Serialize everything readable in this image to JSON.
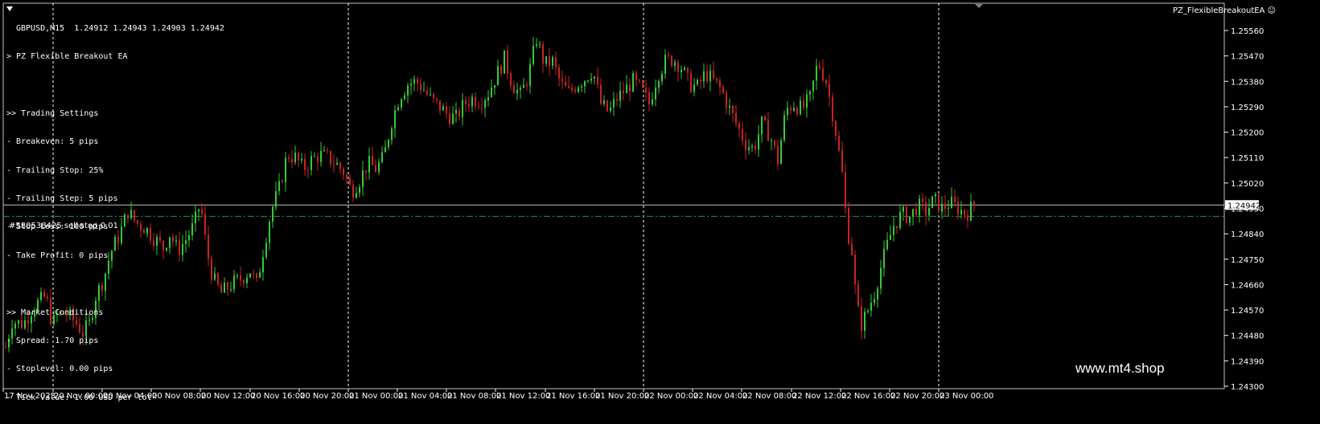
{
  "header": {
    "symbol_line": "GBPUSD,M15  1.24912 1.24943 1.24903 1.24942",
    "ea_line": "> PZ Flexible Breakout EA"
  },
  "panel": {
    "lines": [
      ">> Trading Settings",
      "- Breakeven: 5 pips",
      "- Trailing Stop: 25%",
      "- Trailing Step: 5 pips",
      "- Stop Loss: 100 pips",
      "- Take Profit: 0 pips",
      "",
      ">> Market Conditions",
      "- Spread: 1.70 pips",
      "- Stoplevel: 0.00 pips",
      "- Tick Value: 1.00 USD per lot"
    ]
  },
  "ea_name": "PZ_FlexibleBreakoutEA ☺",
  "order_label": "#580538425 sell stop 0.01",
  "watermark": "www.mt4.shop",
  "colors": {
    "background": "#000000",
    "bull": "#33cc33",
    "bear": "#cc2222",
    "grid": "#ffffff",
    "bid_line": "#bfbfbf",
    "order_line": "#2e8b57"
  },
  "chart_data": {
    "type": "candlestick",
    "price_axis": {
      "ticks": [
        "1.25560",
        "1.25470",
        "1.25380",
        "1.25290",
        "1.25200",
        "1.25110",
        "1.25020",
        "1.24930",
        "1.24840",
        "1.24750",
        "1.24660",
        "1.24570",
        "1.24480",
        "1.24390",
        "1.24300"
      ],
      "range": [
        1.243,
        1.256
      ],
      "current_price": "1.24942",
      "order_price": 1.24902
    },
    "time_axis": {
      "labels": [
        "17 Nov 2023",
        "20 Nov 00:00",
        "20 Nov 04:00",
        "20 Nov 08:00",
        "20 Nov 12:00",
        "20 Nov 16:00",
        "20 Nov 20:00",
        "21 Nov 00:00",
        "21 Nov 04:00",
        "21 Nov 08:00",
        "21 Nov 12:00",
        "21 Nov 16:00",
        "21 Nov 20:00",
        "22 Nov 00:00",
        "22 Nov 04:00",
        "22 Nov 08:00",
        "22 Nov 12:00",
        "22 Nov 16:00",
        "22 Nov 20:00",
        "23 Nov 00:00"
      ],
      "day_separators": [
        "20 Nov 00:00",
        "21 Nov 00:00",
        "22 Nov 00:00",
        "23 Nov 00:00"
      ]
    },
    "close_path": [
      [
        0,
        1.2437
      ],
      [
        14,
        1.2453
      ],
      [
        28,
        1.2452
      ],
      [
        40,
        1.2458
      ],
      [
        56,
        1.2462
      ],
      [
        64,
        1.2452
      ],
      [
        70,
        1.2455
      ],
      [
        80,
        1.2456
      ],
      [
        92,
        1.2453
      ],
      [
        102,
        1.2449
      ],
      [
        110,
        1.2452
      ],
      [
        118,
        1.2462
      ],
      [
        128,
        1.2468
      ],
      [
        136,
        1.2477
      ],
      [
        148,
        1.2484
      ],
      [
        158,
        1.2492
      ],
      [
        168,
        1.2488
      ],
      [
        180,
        1.2486
      ],
      [
        192,
        1.2482
      ],
      [
        202,
        1.2479
      ],
      [
        210,
        1.2484
      ],
      [
        220,
        1.2478
      ],
      [
        230,
        1.2482
      ],
      [
        240,
        1.2487
      ],
      [
        248,
        1.2495
      ],
      [
        256,
        1.2478
      ],
      [
        264,
        1.2468
      ],
      [
        274,
        1.2463
      ],
      [
        286,
        1.2466
      ],
      [
        298,
        1.2468
      ],
      [
        310,
        1.2471
      ],
      [
        318,
        1.2466
      ],
      [
        326,
        1.2478
      ],
      [
        336,
        1.2492
      ],
      [
        346,
        1.25
      ],
      [
        356,
        1.2512
      ],
      [
        366,
        1.2511
      ],
      [
        376,
        1.2507
      ],
      [
        386,
        1.251
      ],
      [
        396,
        1.2512
      ],
      [
        406,
        1.2511
      ],
      [
        416,
        1.2509
      ],
      [
        426,
        1.2506
      ],
      [
        436,
        1.2499
      ],
      [
        446,
        1.2503
      ],
      [
        456,
        1.2509
      ],
      [
        466,
        1.2507
      ],
      [
        476,
        1.2511
      ],
      [
        486,
        1.2524
      ],
      [
        496,
        1.2533
      ],
      [
        506,
        1.2537
      ],
      [
        516,
        1.2538
      ],
      [
        526,
        1.2535
      ],
      [
        536,
        1.2531
      ],
      [
        546,
        1.2529
      ],
      [
        556,
        1.2526
      ],
      [
        566,
        1.2525
      ],
      [
        576,
        1.253
      ],
      [
        586,
        1.2532
      ],
      [
        596,
        1.2531
      ],
      [
        606,
        1.2534
      ],
      [
        616,
        1.254
      ],
      [
        626,
        1.2546
      ],
      [
        636,
        1.2537
      ],
      [
        646,
        1.2533
      ],
      [
        656,
        1.254
      ],
      [
        666,
        1.2553
      ],
      [
        676,
        1.2544
      ],
      [
        686,
        1.2545
      ],
      [
        696,
        1.2537
      ],
      [
        706,
        1.2534
      ],
      [
        716,
        1.2537
      ],
      [
        726,
        1.2539
      ],
      [
        736,
        1.2542
      ],
      [
        746,
        1.253
      ],
      [
        756,
        1.2527
      ],
      [
        766,
        1.2532
      ],
      [
        776,
        1.2535
      ],
      [
        786,
        1.2538
      ],
      [
        796,
        1.2535
      ],
      [
        806,
        1.253
      ],
      [
        816,
        1.254
      ],
      [
        826,
        1.2545
      ],
      [
        836,
        1.2546
      ],
      [
        846,
        1.2543
      ],
      [
        856,
        1.2537
      ],
      [
        866,
        1.2536
      ],
      [
        876,
        1.2541
      ],
      [
        886,
        1.2538
      ],
      [
        896,
        1.2535
      ],
      [
        906,
        1.2528
      ],
      [
        916,
        1.2522
      ],
      [
        926,
        1.2516
      ],
      [
        936,
        1.2514
      ],
      [
        946,
        1.2523
      ],
      [
        956,
        1.2519
      ],
      [
        966,
        1.251
      ],
      [
        976,
        1.2528
      ],
      [
        986,
        1.253
      ],
      [
        996,
        1.2528
      ],
      [
        1006,
        1.2532
      ],
      [
        1016,
        1.2545
      ],
      [
        1026,
        1.2538
      ],
      [
        1036,
        1.2524
      ],
      [
        1046,
        1.2505
      ],
      [
        1052,
        1.2486
      ],
      [
        1058,
        1.2478
      ],
      [
        1064,
        1.2458
      ],
      [
        1070,
        1.2452
      ],
      [
        1078,
        1.2457
      ],
      [
        1086,
        1.2463
      ],
      [
        1094,
        1.2472
      ],
      [
        1102,
        1.248
      ],
      [
        1110,
        1.2487
      ],
      [
        1120,
        1.2491
      ],
      [
        1130,
        1.249
      ],
      [
        1140,
        1.2494
      ],
      [
        1150,
        1.2492
      ],
      [
        1160,
        1.2496
      ],
      [
        1170,
        1.2493
      ],
      [
        1180,
        1.2495
      ],
      [
        1190,
        1.2493
      ],
      [
        1200,
        1.2491
      ],
      [
        1210,
        1.24942
      ]
    ]
  }
}
